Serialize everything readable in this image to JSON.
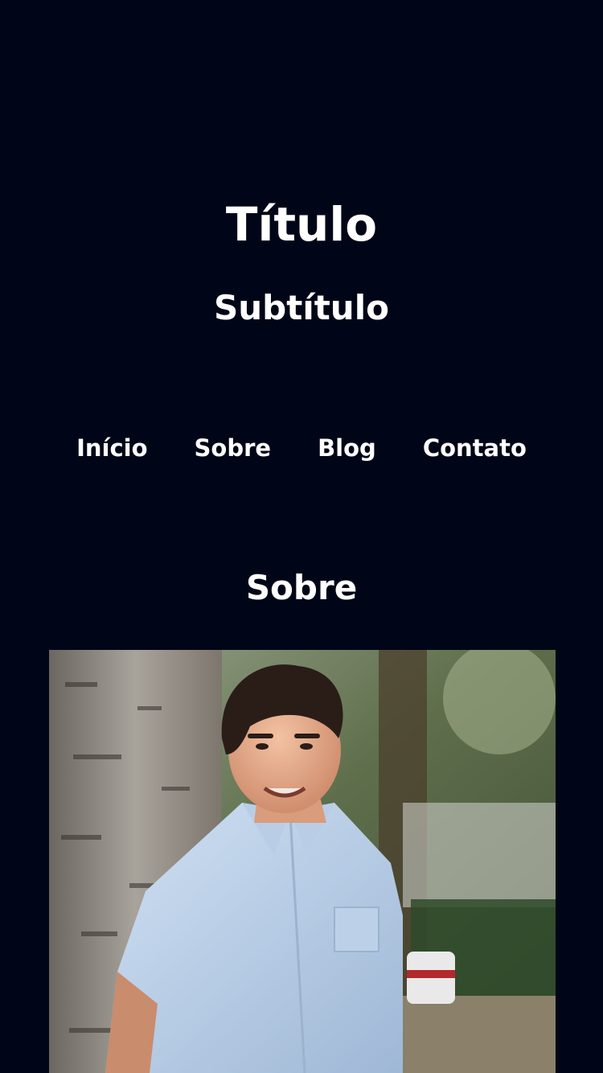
{
  "header": {
    "title": "Título",
    "subtitle": "Subtítulo"
  },
  "nav": {
    "items": [
      {
        "label": "Início"
      },
      {
        "label": "Sobre"
      },
      {
        "label": "Blog"
      },
      {
        "label": "Contato"
      }
    ]
  },
  "about": {
    "heading": "Sobre",
    "photo": "portrait-photo"
  },
  "colors": {
    "background": "#000617",
    "text": "#ffffff"
  }
}
